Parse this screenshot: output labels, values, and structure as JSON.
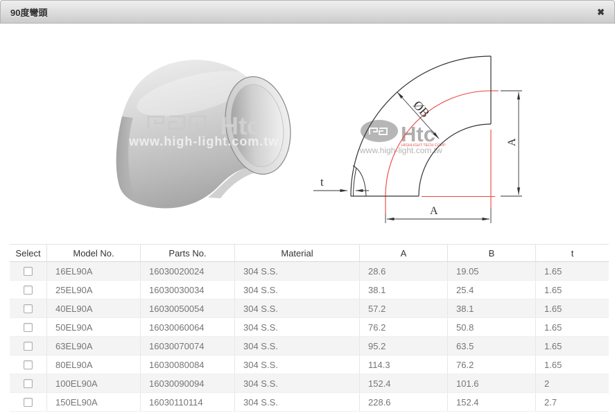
{
  "window": {
    "title": "90度彎頭",
    "close_icon": "✖"
  },
  "photo": {
    "watermark_logo_text": "Htc",
    "watermark_url": "www.high-light.com.tw"
  },
  "drawing": {
    "label_diameter": "ØB",
    "label_thickness": "t",
    "label_a_vertical": "A",
    "label_a_horizontal": "A",
    "watermark_logo_text": "Htc",
    "watermark_sub_text": "HIGHLIGHT TECH CORP",
    "watermark_url": "www.high-light.com.tw",
    "accent_red": "#e8453c",
    "line_color": "#333333"
  },
  "table": {
    "columns": [
      "Select",
      "Model No.",
      "Parts No.",
      "Material",
      "A",
      "B",
      "t"
    ],
    "rows": [
      [
        "16EL90A",
        "16030020024",
        "304 S.S.",
        "28.6",
        "19.05",
        "1.65"
      ],
      [
        "25EL90A",
        "16030030034",
        "304 S.S.",
        "38.1",
        "25.4",
        "1.65"
      ],
      [
        "40EL90A",
        "16030050054",
        "304 S.S.",
        "57.2",
        "38.1",
        "1.65"
      ],
      [
        "50EL90A",
        "16030060064",
        "304 S.S.",
        "76.2",
        "50.8",
        "1.65"
      ],
      [
        "63EL90A",
        "16030070074",
        "304 S.S.",
        "95.2",
        "63.5",
        "1.65"
      ],
      [
        "80EL90A",
        "16030080084",
        "304 S.S.",
        "114.3",
        "76.2",
        "1.65"
      ],
      [
        "100EL90A",
        "16030090094",
        "304 S.S.",
        "152.4",
        "101.6",
        "2"
      ],
      [
        "150EL90A",
        "16030110114",
        "304 S.S.",
        "228.6",
        "152.4",
        "2.7"
      ]
    ]
  }
}
